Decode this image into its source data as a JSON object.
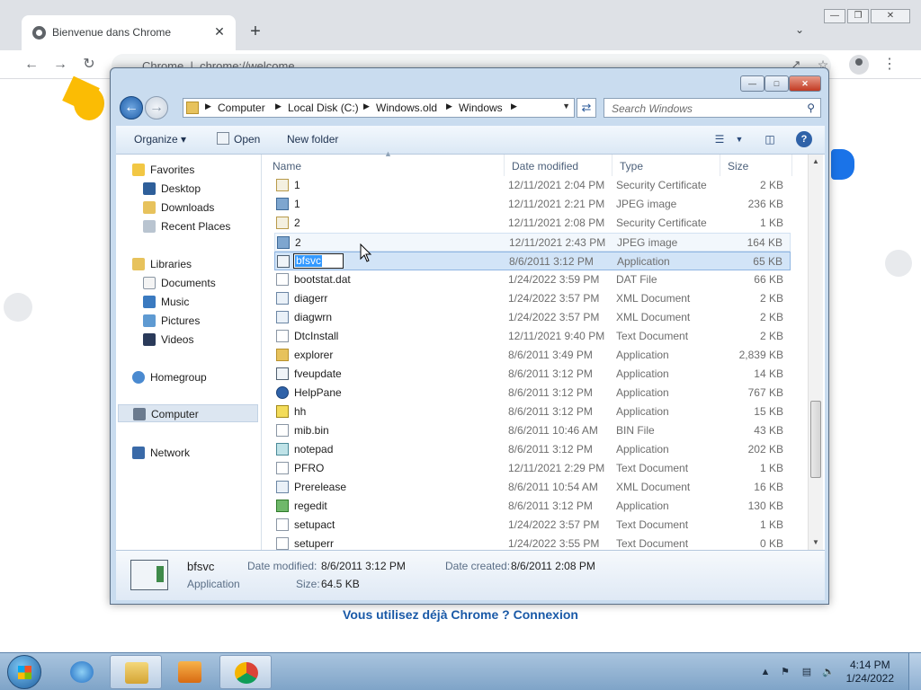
{
  "chrome": {
    "tab_title": "Bienvenue dans Chrome",
    "tab_close": "✕",
    "new_tab": "+",
    "omnibox_site": "Chrome",
    "omnibox_url": "chrome://welcome",
    "signin_text": "Vous utilisez déjà Chrome ? Connexion",
    "accent_color": "#1a73e8"
  },
  "explorer": {
    "breadcrumb": [
      "Computer",
      "Local Disk (C:)",
      "Windows.old",
      "Windows"
    ],
    "search_placeholder": "Search Windows",
    "commands": {
      "organize": "Organize",
      "open": "Open",
      "new_folder": "New folder"
    },
    "nav": {
      "favorites": "Favorites",
      "desktop": "Desktop",
      "downloads": "Downloads",
      "recent_places": "Recent Places",
      "libraries": "Libraries",
      "documents": "Documents",
      "music": "Music",
      "pictures": "Pictures",
      "videos": "Videos",
      "homegroup": "Homegroup",
      "computer": "Computer",
      "network": "Network"
    },
    "columns": {
      "name": "Name",
      "date_modified": "Date modified",
      "type": "Type",
      "size": "Size"
    },
    "files": [
      {
        "name": "1",
        "date": "12/11/2021 2:04 PM",
        "type": "Security Certificate",
        "size": "2 KB",
        "icon": "cert"
      },
      {
        "name": "1",
        "date": "12/11/2021 2:21 PM",
        "type": "JPEG image",
        "size": "236 KB",
        "icon": "img"
      },
      {
        "name": "2",
        "date": "12/11/2021 2:08 PM",
        "type": "Security Certificate",
        "size": "1 KB",
        "icon": "cert"
      },
      {
        "name": "2",
        "date": "12/11/2021 2:43 PM",
        "type": "JPEG image",
        "size": "164 KB",
        "icon": "img"
      },
      {
        "name": "bfsvc",
        "date": "8/6/2011 3:12 PM",
        "type": "Application",
        "size": "65 KB",
        "icon": "app"
      },
      {
        "name": "bootstat.dat",
        "date": "1/24/2022 3:59 PM",
        "type": "DAT File",
        "size": "66 KB",
        "icon": "file"
      },
      {
        "name": "diagerr",
        "date": "1/24/2022 3:57 PM",
        "type": "XML Document",
        "size": "2 KB",
        "icon": "xml"
      },
      {
        "name": "diagwrn",
        "date": "1/24/2022 3:57 PM",
        "type": "XML Document",
        "size": "2 KB",
        "icon": "xml"
      },
      {
        "name": "DtcInstall",
        "date": "12/11/2021 9:40 PM",
        "type": "Text Document",
        "size": "2 KB",
        "icon": "file"
      },
      {
        "name": "explorer",
        "date": "8/6/2011 3:49 PM",
        "type": "Application",
        "size": "2,839 KB",
        "icon": "folderapp"
      },
      {
        "name": "fveupdate",
        "date": "8/6/2011 3:12 PM",
        "type": "Application",
        "size": "14 KB",
        "icon": "app"
      },
      {
        "name": "HelpPane",
        "date": "8/6/2011 3:12 PM",
        "type": "Application",
        "size": "767 KB",
        "icon": "help"
      },
      {
        "name": "hh",
        "date": "8/6/2011 3:12 PM",
        "type": "Application",
        "size": "15 KB",
        "icon": "hh"
      },
      {
        "name": "mib.bin",
        "date": "8/6/2011 10:46 AM",
        "type": "BIN File",
        "size": "43 KB",
        "icon": "file"
      },
      {
        "name": "notepad",
        "date": "8/6/2011 3:12 PM",
        "type": "Application",
        "size": "202 KB",
        "icon": "np"
      },
      {
        "name": "PFRO",
        "date": "12/11/2021 2:29 PM",
        "type": "Text Document",
        "size": "1 KB",
        "icon": "file"
      },
      {
        "name": "Prerelease",
        "date": "8/6/2011 10:54 AM",
        "type": "XML Document",
        "size": "16 KB",
        "icon": "xml"
      },
      {
        "name": "regedit",
        "date": "8/6/2011 3:12 PM",
        "type": "Application",
        "size": "130 KB",
        "icon": "reg"
      },
      {
        "name": "setupact",
        "date": "1/24/2022 3:57 PM",
        "type": "Text Document",
        "size": "1 KB",
        "icon": "file"
      },
      {
        "name": "setuperr",
        "date": "1/24/2022 3:55 PM",
        "type": "Text Document",
        "size": "0 KB",
        "icon": "file"
      }
    ],
    "rename_value": "bfsvc",
    "details": {
      "name": "bfsvc",
      "kind": "Application",
      "date_modified_label": "Date modified:",
      "date_modified": "8/6/2011 3:12 PM",
      "size_label": "Size:",
      "size": "64.5 KB",
      "date_created_label": "Date created:",
      "date_created": "8/6/2011 2:08 PM"
    }
  },
  "taskbar": {
    "time": "4:14 PM",
    "date": "1/24/2022"
  }
}
